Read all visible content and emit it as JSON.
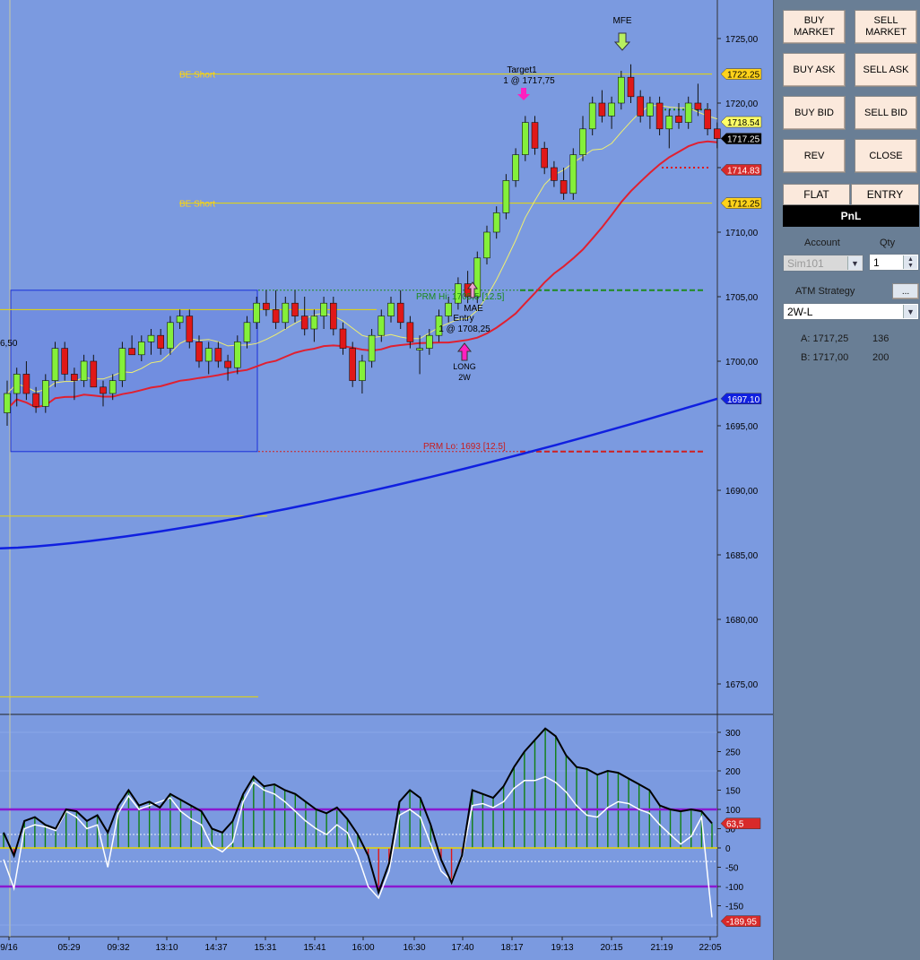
{
  "chart": {
    "price_axis_labels": [
      "1725,00",
      "1720,00",
      "1715,00",
      "1710,00",
      "1705,00",
      "1700,00",
      "1695,00",
      "1690,00",
      "1685,00",
      "1680,00",
      "1675,00"
    ],
    "price_axis_values": [
      1725,
      1720,
      1715,
      1710,
      1705,
      1700,
      1695,
      1690,
      1685,
      1680,
      1675
    ],
    "price_tags": [
      {
        "label": "1722.25",
        "value": 1722.25,
        "color": "#ffd21a",
        "text_color": "#000"
      },
      {
        "label": "1718.54",
        "value": 1718.54,
        "color": "#ffff66",
        "text_color": "#000"
      },
      {
        "label": "1717.25",
        "value": 1717.25,
        "color": "#000000",
        "text_color": "#fff"
      },
      {
        "label": "1714.83",
        "value": 1714.83,
        "color": "#d82a2a",
        "text_color": "#fff"
      },
      {
        "label": "1712.25",
        "value": 1712.25,
        "color": "#ffd21a",
        "text_color": "#000"
      },
      {
        "label": "1697.10",
        "value": 1697.1,
        "color": "#1020e0",
        "text_color": "#fff"
      }
    ],
    "osc_axis_labels": [
      "300",
      "250",
      "200",
      "150",
      "100",
      "50",
      "0",
      "-50",
      "-100",
      "-150"
    ],
    "osc_axis_values": [
      300,
      250,
      200,
      150,
      100,
      50,
      0,
      -50,
      -100,
      -150
    ],
    "osc_tags": [
      {
        "label": "63,5",
        "value": 63.5,
        "color": "#d82a2a"
      },
      {
        "label": "-189,95",
        "value": -189.95,
        "color": "#d82a2a"
      }
    ],
    "time_labels": [
      "9/16",
      "05:29",
      "09:32",
      "13:10",
      "14:37",
      "15:31",
      "15:41",
      "16:00",
      "16:30",
      "17:40",
      "18:17",
      "19:13",
      "20:15",
      "21:19",
      "22:05"
    ],
    "annotations": {
      "mfe": "MFE",
      "target_line1": "Target1",
      "target_line2": "1 @ 1717,75",
      "mae": "MAE",
      "entry_line1": "Entry",
      "entry_line2": "1 @ 1708,25",
      "long_line1": "LONG",
      "long_line2": "2W",
      "prm_hi": "PRM Hi: 1705,5 [12.5]",
      "prm_lo": "PRM Lo: 1693 [12.5]",
      "be_short_upper": "BE Short",
      "be_short_lower": "BE Short",
      "left_cut": "6,50"
    }
  },
  "chart_data": {
    "type": "candlestick",
    "price_range": [
      1670.5,
      1727
    ],
    "oscillator_range": [
      -200,
      330
    ],
    "candles": [
      [
        1696.0,
        1698.5,
        1695.0,
        1697.5
      ],
      [
        1697.5,
        1699.5,
        1696.5,
        1699.0
      ],
      [
        1699.0,
        1700.0,
        1697.0,
        1697.5
      ],
      [
        1697.5,
        1698.0,
        1696.0,
        1696.5
      ],
      [
        1696.5,
        1699.0,
        1696.0,
        1698.5
      ],
      [
        1698.5,
        1701.5,
        1698.0,
        1701.0
      ],
      [
        1701.0,
        1701.5,
        1698.5,
        1699.0
      ],
      [
        1699.0,
        1699.5,
        1697.0,
        1698.5
      ],
      [
        1698.5,
        1700.5,
        1698.0,
        1700.0
      ],
      [
        1700.0,
        1700.5,
        1698.0,
        1698.0
      ],
      [
        1698.0,
        1698.5,
        1696.5,
        1697.5
      ],
      [
        1697.5,
        1699.0,
        1697.0,
        1698.5
      ],
      [
        1698.5,
        1701.5,
        1698.0,
        1701.0
      ],
      [
        1701.0,
        1702.0,
        1700.5,
        1700.5
      ],
      [
        1700.5,
        1702.0,
        1700.0,
        1701.5
      ],
      [
        1701.5,
        1702.5,
        1700.5,
        1702.0
      ],
      [
        1702.0,
        1702.5,
        1700.5,
        1701.0
      ],
      [
        1701.0,
        1703.5,
        1700.5,
        1703.0
      ],
      [
        1703.0,
        1704.0,
        1702.5,
        1703.5
      ],
      [
        1703.5,
        1704.0,
        1701.0,
        1701.5
      ],
      [
        1701.5,
        1702.0,
        1699.5,
        1700.0
      ],
      [
        1700.0,
        1701.5,
        1699.0,
        1701.0
      ],
      [
        1701.0,
        1701.5,
        1699.5,
        1700.0
      ],
      [
        1700.0,
        1700.5,
        1698.5,
        1699.5
      ],
      [
        1699.5,
        1702.0,
        1699.0,
        1701.5
      ],
      [
        1701.5,
        1703.5,
        1701.0,
        1703.0
      ],
      [
        1703.0,
        1705.0,
        1702.5,
        1704.5
      ],
      [
        1704.5,
        1705.5,
        1703.5,
        1704.0
      ],
      [
        1704.0,
        1705.5,
        1702.5,
        1703.0
      ],
      [
        1703.0,
        1705.0,
        1702.5,
        1704.5
      ],
      [
        1704.5,
        1705.5,
        1703.0,
        1703.5
      ],
      [
        1703.5,
        1705.0,
        1702.0,
        1702.5
      ],
      [
        1702.5,
        1704.0,
        1701.5,
        1703.5
      ],
      [
        1703.5,
        1705.0,
        1702.5,
        1704.5
      ],
      [
        1704.5,
        1705.0,
        1702.0,
        1702.5
      ],
      [
        1702.5,
        1703.0,
        1700.5,
        1701.0
      ],
      [
        1701.0,
        1701.5,
        1698.0,
        1698.5
      ],
      [
        1698.5,
        1700.5,
        1697.5,
        1700.0
      ],
      [
        1700.0,
        1702.5,
        1699.5,
        1702.0
      ],
      [
        1702.0,
        1704.0,
        1701.5,
        1703.5
      ],
      [
        1703.5,
        1705.0,
        1703.0,
        1704.5
      ],
      [
        1704.5,
        1705.5,
        1702.5,
        1703.0
      ],
      [
        1703.0,
        1703.5,
        1701.0,
        1701.5
      ],
      [
        1701.0,
        1702.0,
        1699.0,
        1701.0
      ],
      [
        1701.0,
        1702.5,
        1700.5,
        1702.0
      ],
      [
        1702.0,
        1704.0,
        1701.5,
        1703.5
      ],
      [
        1703.5,
        1705.0,
        1703.0,
        1704.5
      ],
      [
        1704.5,
        1706.5,
        1704.0,
        1706.0
      ],
      [
        1706.0,
        1707.0,
        1704.5,
        1705.0
      ],
      [
        1705.0,
        1708.5,
        1704.5,
        1708.0
      ],
      [
        1708.0,
        1710.5,
        1707.5,
        1710.0
      ],
      [
        1710.0,
        1712.0,
        1709.5,
        1711.5
      ],
      [
        1711.5,
        1714.5,
        1711.0,
        1714.0
      ],
      [
        1714.0,
        1716.5,
        1713.5,
        1716.0
      ],
      [
        1716.0,
        1719.0,
        1715.5,
        1718.5
      ],
      [
        1718.5,
        1719.0,
        1716.0,
        1716.5
      ],
      [
        1716.5,
        1717.0,
        1714.5,
        1715.0
      ],
      [
        1715.0,
        1715.5,
        1713.5,
        1714.0
      ],
      [
        1714.0,
        1715.0,
        1712.5,
        1713.0
      ],
      [
        1713.0,
        1716.5,
        1712.5,
        1716.0
      ],
      [
        1716.0,
        1719.0,
        1715.5,
        1718.0
      ],
      [
        1718.0,
        1720.5,
        1717.5,
        1720.0
      ],
      [
        1720.0,
        1721.0,
        1718.5,
        1719.0
      ],
      [
        1719.0,
        1720.5,
        1718.0,
        1720.0
      ],
      [
        1720.0,
        1722.5,
        1719.5,
        1722.0
      ],
      [
        1722.0,
        1723.0,
        1720.0,
        1720.5
      ],
      [
        1720.5,
        1721.0,
        1718.5,
        1719.0
      ],
      [
        1719.0,
        1720.5,
        1718.0,
        1720.0
      ],
      [
        1720.0,
        1720.5,
        1717.5,
        1718.0
      ],
      [
        1718.0,
        1719.5,
        1716.5,
        1719.0
      ],
      [
        1719.0,
        1720.0,
        1718.0,
        1718.5
      ],
      [
        1718.5,
        1720.5,
        1718.0,
        1720.0
      ],
      [
        1720.0,
        1721.5,
        1719.0,
        1719.5
      ],
      [
        1719.5,
        1720.0,
        1717.5,
        1718.0
      ],
      [
        1718.0,
        1718.5,
        1716.5,
        1717.25
      ]
    ],
    "oscillator": [
      40,
      -20,
      70,
      80,
      60,
      50,
      100,
      95,
      70,
      85,
      40,
      110,
      150,
      110,
      120,
      105,
      140,
      125,
      110,
      95,
      50,
      40,
      70,
      140,
      185,
      160,
      165,
      150,
      140,
      120,
      100,
      90,
      105,
      75,
      35,
      -20,
      -115,
      -40,
      120,
      150,
      130,
      60,
      -30,
      -90,
      -20,
      150,
      140,
      130,
      160,
      210,
      250,
      280,
      310,
      290,
      240,
      210,
      205,
      190,
      200,
      195,
      180,
      165,
      150,
      110,
      100,
      95,
      100,
      95,
      64
    ],
    "oscillator_signal": [
      -30,
      -105,
      50,
      60,
      55,
      45,
      95,
      80,
      50,
      60,
      -50,
      90,
      135,
      100,
      110,
      120,
      130,
      95,
      75,
      60,
      5,
      -10,
      15,
      120,
      170,
      150,
      140,
      120,
      95,
      70,
      50,
      35,
      60,
      40,
      -20,
      -100,
      -130,
      -60,
      85,
      100,
      80,
      10,
      -60,
      -85,
      -25,
      110,
      115,
      105,
      120,
      155,
      175,
      175,
      185,
      170,
      145,
      110,
      85,
      80,
      105,
      120,
      115,
      100,
      90,
      60,
      35,
      10,
      30,
      80,
      -180
    ]
  },
  "panel": {
    "buttons": {
      "buy_market": "BUY MARKET",
      "sell_market": "SELL MARKET",
      "buy_ask": "BUY ASK",
      "sell_ask": "SELL ASK",
      "buy_bid": "BUY BID",
      "sell_bid": "SELL BID",
      "rev": "REV",
      "close": "CLOSE"
    },
    "flat_label": "FLAT",
    "entry_label": "ENTRY",
    "pnl_label": "PnL",
    "account_label": "Account",
    "qty_label": "Qty",
    "account_value": "Sim101",
    "qty_value": "1",
    "atm_label": "ATM Strategy",
    "atm_more": "...",
    "atm_value": "2W-L",
    "ask_label": "A: 1717,25",
    "ask_size": "136",
    "bid_label": "B: 1717,00",
    "bid_size": "200"
  }
}
